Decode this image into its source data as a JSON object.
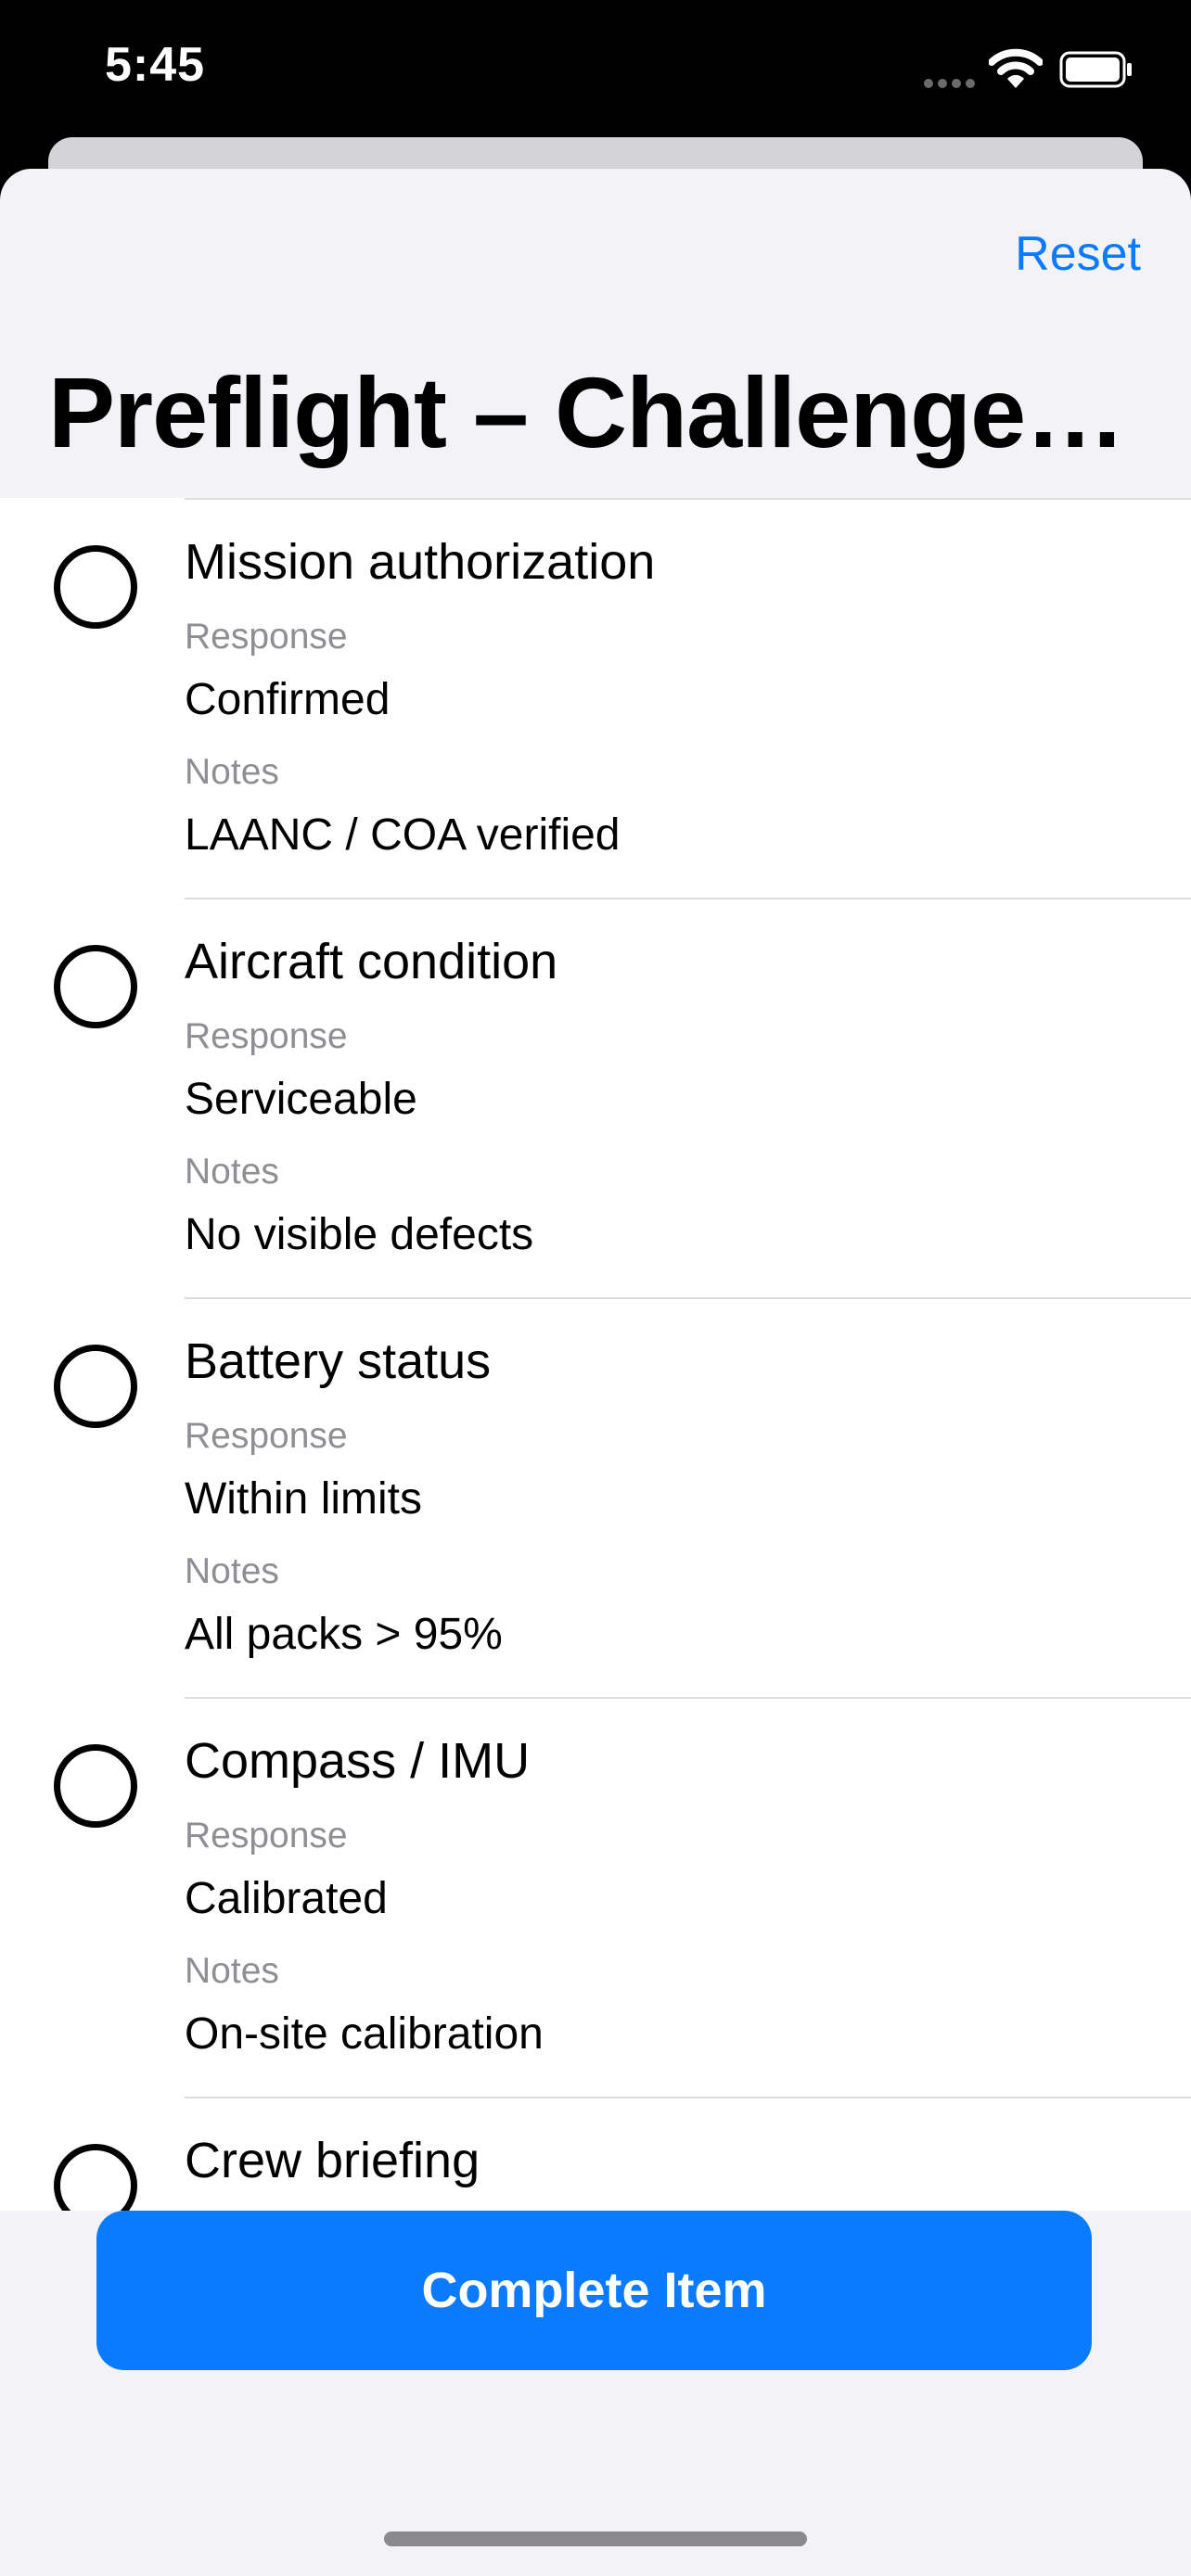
{
  "status_bar": {
    "time": "5:45"
  },
  "header": {
    "reset_label": "Reset",
    "title": "Preflight – Challenge…"
  },
  "checklist": {
    "items": [
      {
        "title": "Mission authorization",
        "response_label": "Response",
        "response": "Confirmed",
        "notes_label": "Notes",
        "notes": "LAANC / COA verified",
        "checked": false
      },
      {
        "title": "Aircraft condition",
        "response_label": "Response",
        "response": "Serviceable",
        "notes_label": "Notes",
        "notes": "No visible defects",
        "checked": false
      },
      {
        "title": "Battery status",
        "response_label": "Response",
        "response": "Within limits",
        "notes_label": "Notes",
        "notes": "All packs > 95%",
        "checked": false
      },
      {
        "title": "Compass / IMU",
        "response_label": "Response",
        "response": "Calibrated",
        "notes_label": "Notes",
        "notes": "On-site calibration",
        "checked": false
      },
      {
        "title": "Crew briefing",
        "checked": false
      }
    ]
  },
  "footer": {
    "complete_label": "Complete Item"
  },
  "colors": {
    "accent": "#0a7aff",
    "sheet_background": "#f2f2f7",
    "secondary_text": "#8e8e93"
  },
  "icons": {
    "signal": "cellular-signal-icon",
    "wifi": "wifi-icon",
    "battery": "battery-icon"
  }
}
